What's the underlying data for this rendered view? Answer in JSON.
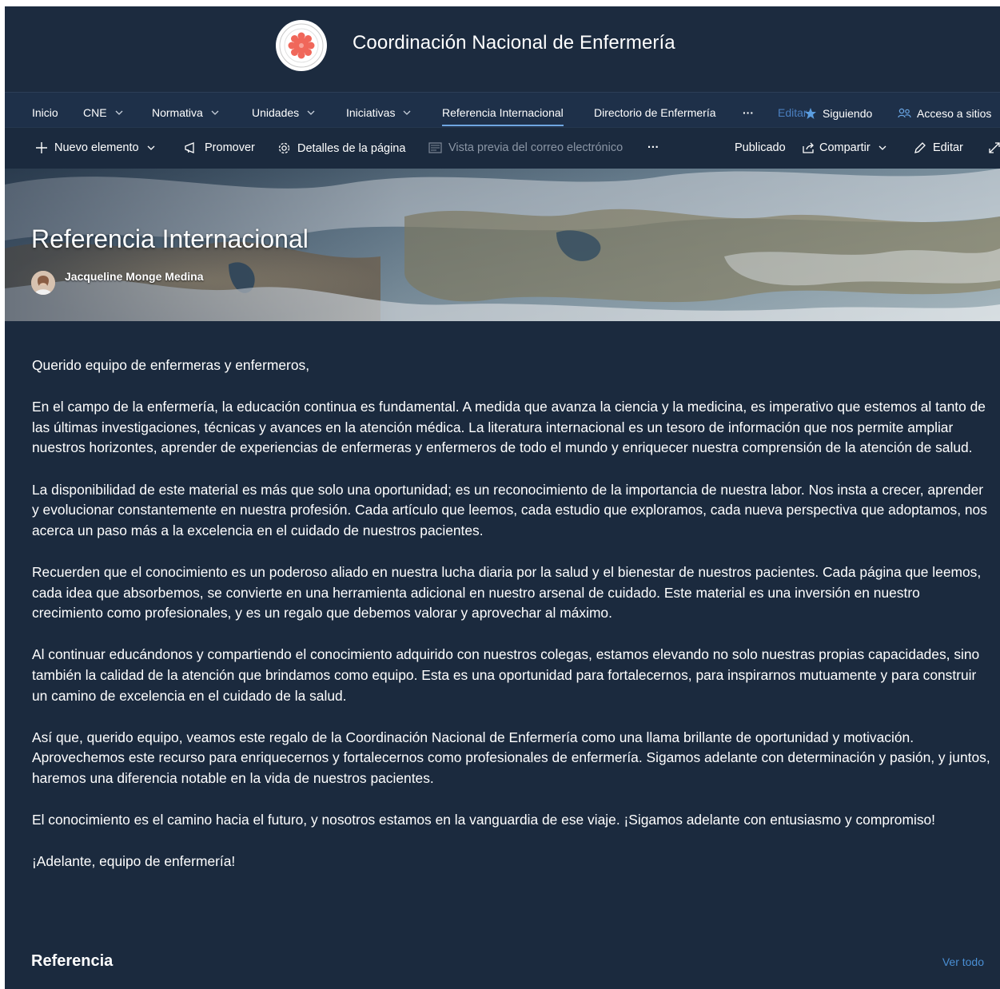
{
  "site": {
    "title": "Coordinación Nacional de Enfermería",
    "logo": "cne-seal-logo"
  },
  "nav": {
    "items": [
      {
        "label": "Inicio",
        "dropdown": false
      },
      {
        "label": "CNE",
        "dropdown": true
      },
      {
        "label": "Normativa",
        "dropdown": true
      },
      {
        "label": "Unidades",
        "dropdown": true
      },
      {
        "label": "Iniciativas",
        "dropdown": true
      },
      {
        "label": "Referencia Internacional",
        "dropdown": false,
        "active": true
      },
      {
        "label": "Directorio de Enfermería",
        "dropdown": false
      }
    ],
    "more": "···",
    "edit": "Editar",
    "following": "Siguiendo",
    "access": "Acceso a sitios"
  },
  "commandbar": {
    "new_item": "Nuevo elemento",
    "promote": "Promover",
    "page_details": "Detalles de la página",
    "email_preview": "Vista previa del correo electrónico",
    "more": "···",
    "published": "Publicado",
    "share": "Compartir",
    "edit": "Editar"
  },
  "hero": {
    "title": "Referencia Internacional",
    "author": "Jacqueline Monge Medina"
  },
  "content": {
    "paragraphs": [
      "Querido equipo de enfermeras y enfermeros,",
      "En el campo de la enfermería, la educación continua es fundamental. A medida que avanza la ciencia y la medicina, es imperativo que estemos al tanto de las últimas investigaciones, técnicas y avances en la atención médica. La literatura internacional es un tesoro de información que nos permite ampliar nuestros horizontes, aprender de experiencias de enfermeras y enfermeros de todo el mundo y enriquecer nuestra comprensión de la atención de salud.",
      "La disponibilidad de este material es más que solo una oportunidad; es un reconocimiento de la importancia de nuestra labor. Nos insta a crecer, aprender y evolucionar constantemente en nuestra profesión. Cada artículo que leemos, cada estudio que exploramos, cada nueva perspectiva que adoptamos, nos acerca un paso más a la excelencia en el cuidado de nuestros pacientes.",
      "Recuerden que el conocimiento es un poderoso aliado en nuestra lucha diaria por la salud y el bienestar de nuestros pacientes. Cada página que leemos, cada idea que absorbemos, se convierte en una herramienta adicional en nuestro arsenal de cuidado. Este material es una inversión en nuestro crecimiento como profesionales, y es un regalo que debemos valorar y aprovechar al máximo.",
      "Al continuar educándonos y compartiendo el conocimiento adquirido con nuestros colegas, estamos elevando no solo nuestras propias capacidades, sino también la calidad de la atención que brindamos como equipo. Esta es una oportunidad para fortalecernos, para inspirarnos mutuamente y para construir un camino de excelencia en el cuidado de la salud.",
      "Así que, querido equipo, veamos este regalo de la Coordinación Nacional de Enfermería como una llama brillante de oportunidad y motivación. Aprovechemos este recurso para enriquecernos y fortalecernos como profesionales de enfermería. Sigamos adelante con determinación y pasión, y juntos, haremos una diferencia notable en la vida de nuestros pacientes.",
      "El conocimiento es el camino hacia el futuro, y nosotros estamos en la vanguardia de ese viaje. ¡Sigamos adelante con entusiasmo y compromiso!",
      "¡Adelante, equipo de enfermería!"
    ]
  },
  "section": {
    "title": "Referencia",
    "see_all": "Ver todo"
  },
  "colors": {
    "background": "#1b2a3e",
    "nav": "#1e3049",
    "accent": "#4a8fd4",
    "logo_flower": "#f0675a"
  }
}
